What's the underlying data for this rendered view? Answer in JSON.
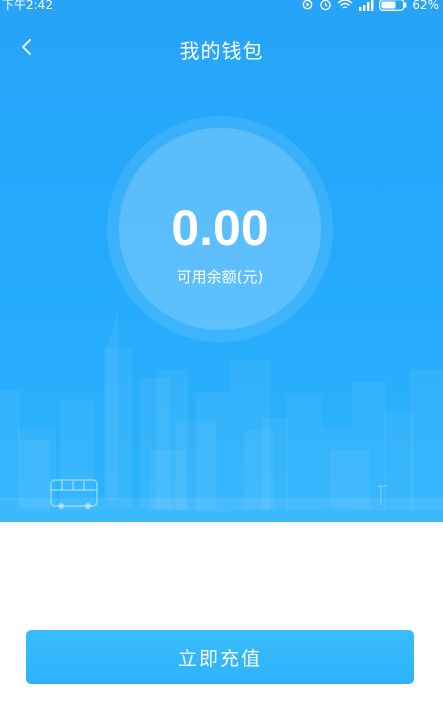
{
  "status_bar": {
    "time": "下午2:42",
    "battery": "62%"
  },
  "header": {
    "title": "我的钱包",
    "back_icon": "chevron-left-icon"
  },
  "balance": {
    "amount": "0.00",
    "label": "可用余额(元)"
  },
  "actions": {
    "recharge_label": "立即充值"
  },
  "colors": {
    "hero_blue": "#24a9fb",
    "button_blue": "#36b9fc",
    "text_white": "#ffffff"
  }
}
